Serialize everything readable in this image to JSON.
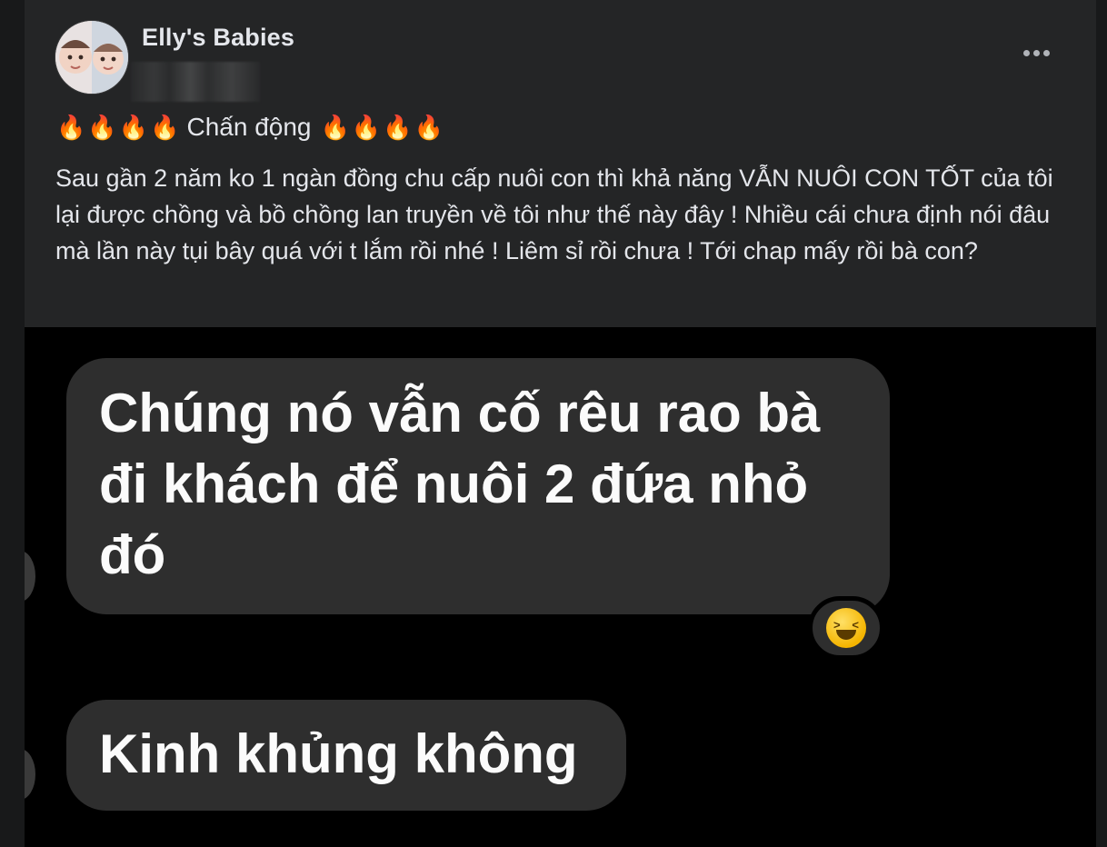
{
  "post": {
    "author": "Elly's Babies",
    "title": "Chấn động",
    "fire_emoji": "🔥",
    "body": "Sau gần 2 năm ko 1 ngàn đồng chu cấp nuôi con thì khả năng VẪN NUÔI CON TỐT của tôi lại được chồng và bồ chồng lan truyền về tôi như thế này đây ! Nhiều cái chưa định nói đâu mà lần này tụi bây quá với t lắm rồi nhé ! Liêm sỉ rồi chưa ! Tới chap mấy rồi bà con?"
  },
  "screenshot": {
    "message_1": "Chúng nó vẫn cố rêu rao bà đi khách để nuôi 2 đứa nhỏ đó",
    "message_2": "Kinh khủng không",
    "reaction": "laughing-squinting-face"
  },
  "icons": {
    "more": "more-horizontal-icon"
  },
  "colors": {
    "card_bg": "#242526",
    "text": "#e4e6eb",
    "bubble_bg": "#2e2e2e"
  }
}
